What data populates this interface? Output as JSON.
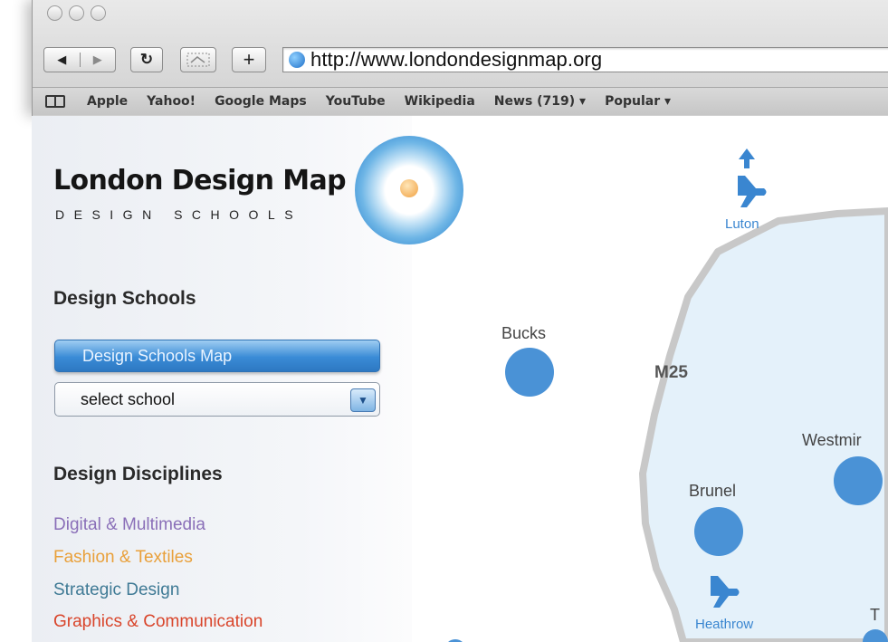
{
  "toolbar": {
    "back_glyph": "◀",
    "forward_glyph": "▶",
    "reload_glyph": "↻",
    "add_glyph": "+",
    "url": "http://www.londondesignmap.org"
  },
  "bookmarks": [
    "Apple",
    "Yahoo!",
    "Google Maps",
    "YouTube",
    "Wikipedia",
    "News (719) ▾",
    "Popular ▾"
  ],
  "logo": {
    "title": "London Design Map",
    "subtitle": "DESIGN SCHOOLS"
  },
  "sidebar": {
    "schools_heading": "Design Schools",
    "map_button": "Design Schools Map",
    "select_value": "select school",
    "disciplines_heading": "Design Disciplines",
    "disciplines": [
      {
        "label": "Digital & Multimedia",
        "color": "#8a6fb8"
      },
      {
        "label": "Fashion & Textiles",
        "color": "#e9a03a"
      },
      {
        "label": "Strategic Design",
        "color": "#3f7a95"
      },
      {
        "label": "Graphics & Communication",
        "color": "#d9452b"
      }
    ]
  },
  "map": {
    "road_label": "M25",
    "airports": [
      "Luton",
      "Heathrow"
    ],
    "schools": [
      "Bucks",
      "Brunel",
      "Westmir",
      "T"
    ],
    "accent": "#4a92d6"
  }
}
